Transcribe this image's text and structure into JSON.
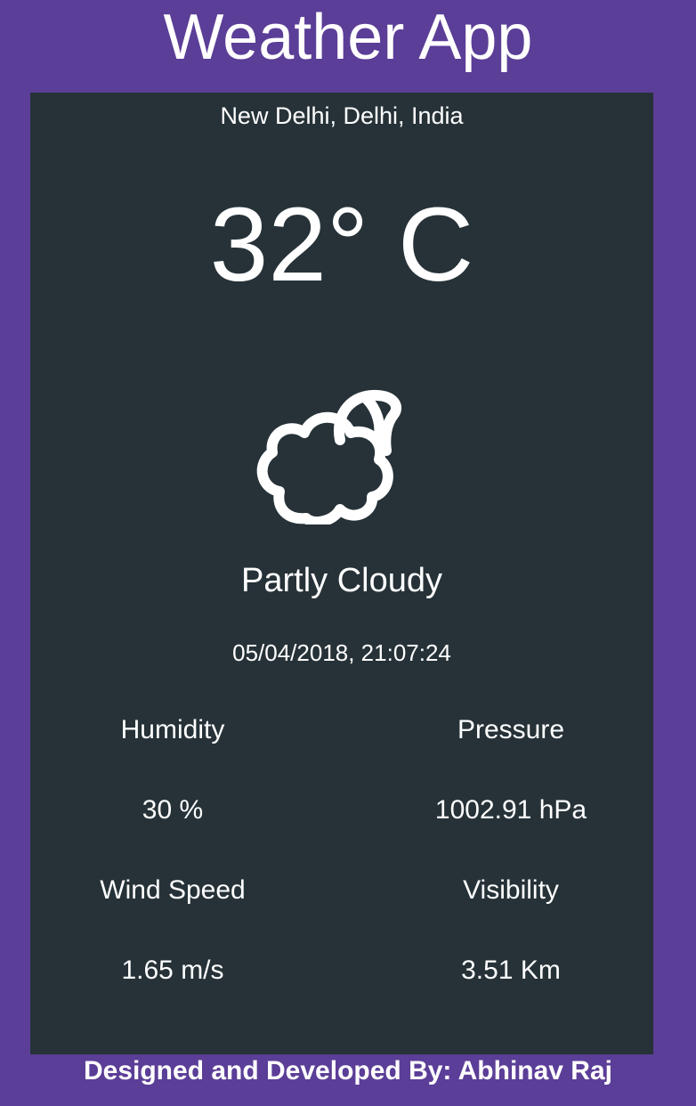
{
  "header": {
    "title": "Weather App"
  },
  "weather": {
    "location": "New Delhi, Delhi, India",
    "temperature": "32° C",
    "icon": "partly-cloudy-icon",
    "condition": "Partly Cloudy",
    "datetime": "05/04/2018, 21:07:24"
  },
  "stats": {
    "humidity_label": "Humidity",
    "humidity_value": "30 %",
    "pressure_label": "Pressure",
    "pressure_value": "1002.91 hPa",
    "wind_label": "Wind Speed",
    "wind_value": "1.65 m/s",
    "visibility_label": "Visibility",
    "visibility_value": "3.51 Km"
  },
  "footer": {
    "credit": "Designed and Developed By: Abhinav Raj"
  },
  "colors": {
    "background": "#5b3e97",
    "card": "#263238",
    "text": "#ffffff"
  }
}
